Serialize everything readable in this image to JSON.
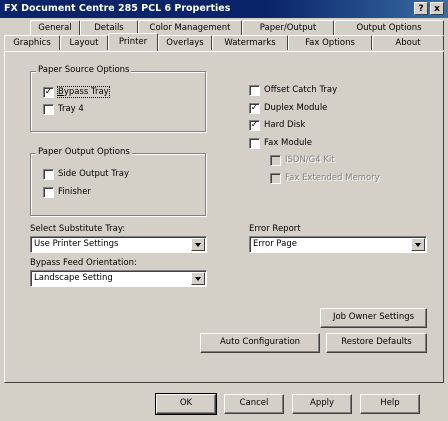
{
  "window": {
    "title": "FX Document Centre 285 PCL 6 Properties",
    "help_btn": "?",
    "close_btn": "x"
  },
  "tabs": {
    "row1": [
      "General",
      "Details",
      "Color Management",
      "Paper/Output",
      "Output Options"
    ],
    "row2": [
      "Graphics",
      "Layout",
      "Printer",
      "Overlays",
      "Watermarks",
      "Fax Options",
      "About"
    ],
    "active": "Printer"
  },
  "paper_source": {
    "title": "Paper Source Options",
    "bypass_tray": {
      "label": "Bypass Tray",
      "checked": true
    },
    "tray4": {
      "label": "Tray 4",
      "checked": false
    }
  },
  "paper_output": {
    "title": "Paper Output Options",
    "side_output_tray": {
      "label": "Side Output Tray",
      "checked": false
    },
    "finisher": {
      "label": "Finisher",
      "checked": false
    }
  },
  "options": {
    "offset_catch_tray": {
      "label": "Offset Catch Tray",
      "checked": false
    },
    "duplex_module": {
      "label": "Duplex Module",
      "checked": true
    },
    "hard_disk": {
      "label": "Hard Disk",
      "checked": true
    },
    "fax_module": {
      "label": "Fax Module",
      "checked": false
    },
    "isdn_g4_kit": {
      "label": "ISDN/G4 Kit",
      "checked": false,
      "enabled": false
    },
    "fax_extended_memory": {
      "label": "Fax Extended Memory",
      "checked": false,
      "enabled": false
    }
  },
  "substitute_tray": {
    "label": "Select Substitute Tray:",
    "value": "Use Printer Settings"
  },
  "error_report": {
    "label": "Error Report",
    "value": "Error Page"
  },
  "bypass_feed": {
    "label": "Bypass Feed Orientation:",
    "value": "Landscape Setting"
  },
  "buttons": {
    "job_owner": "Job Owner Settings",
    "auto_config": "Auto Configuration",
    "restore_defaults": "Restore Defaults",
    "ok": "OK",
    "cancel": "Cancel",
    "apply": "Apply",
    "help": "Help"
  },
  "check_mark": "✓"
}
